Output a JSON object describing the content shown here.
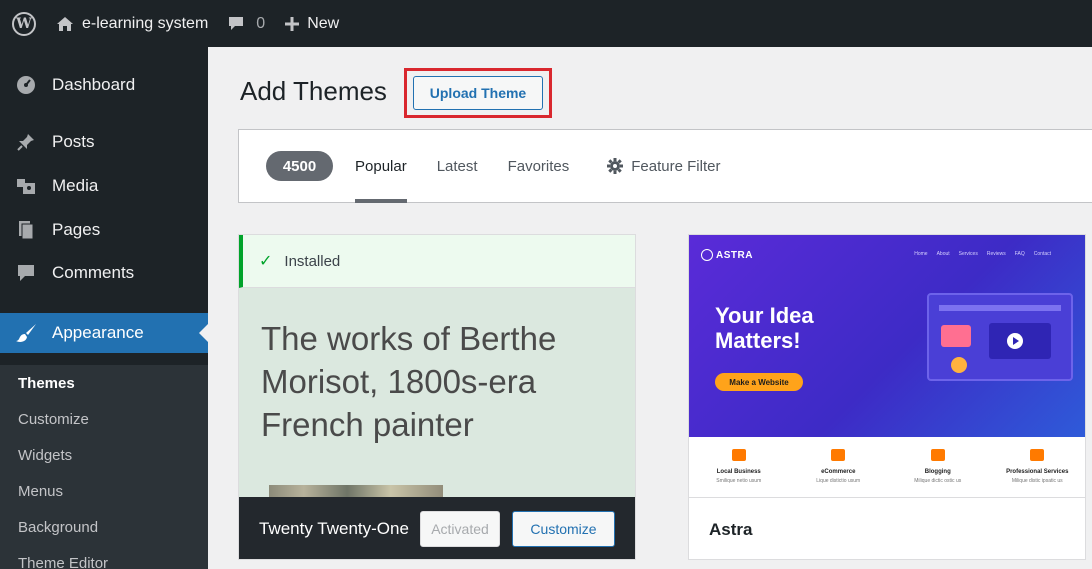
{
  "adminbar": {
    "site_name": "e-learning system",
    "comments_count": "0",
    "new_label": "New"
  },
  "sidebar": {
    "items": [
      {
        "label": "Dashboard",
        "icon": "dashboard-icon"
      },
      {
        "label": "Posts",
        "icon": "pin-icon"
      },
      {
        "label": "Media",
        "icon": "media-icon"
      },
      {
        "label": "Pages",
        "icon": "pages-icon"
      },
      {
        "label": "Comments",
        "icon": "comment-icon"
      },
      {
        "label": "Appearance",
        "icon": "brush-icon"
      }
    ],
    "submenu": [
      "Themes",
      "Customize",
      "Widgets",
      "Menus",
      "Background",
      "Theme Editor"
    ]
  },
  "main": {
    "title": "Add Themes",
    "upload_button": "Upload Theme",
    "filter": {
      "count": "4500",
      "tabs": [
        "Popular",
        "Latest",
        "Favorites"
      ],
      "feature_filter": "Feature Filter"
    }
  },
  "themes": [
    {
      "status": "Installed",
      "preview_text": "The works of Berthe Morisot, 1800s-era French painter",
      "name": "Twenty Twenty-One",
      "activated_label": "Activated",
      "customize_label": "Customize"
    },
    {
      "name": "Astra",
      "preview": {
        "logo": "ASTRA",
        "nav": [
          "Home",
          "About",
          "Services",
          "Reviews",
          "FAQ",
          "Contact"
        ],
        "headline": "Your Idea Matters!",
        "cta": "Make a Website",
        "features": [
          {
            "title": "Local Business",
            "desc": "Smilique netio usum"
          },
          {
            "title": "eCommerce",
            "desc": "Lique distictio usum"
          },
          {
            "title": "Blogging",
            "desc": "Milique dictic ostic us"
          },
          {
            "title": "Professional Services",
            "desc": "Milique distic ipsatic us"
          }
        ]
      }
    }
  ],
  "colors": {
    "admin_bg": "#1d2327",
    "accent": "#2271b1",
    "highlight_border": "#d9272e",
    "installed_green": "#00a32a"
  }
}
